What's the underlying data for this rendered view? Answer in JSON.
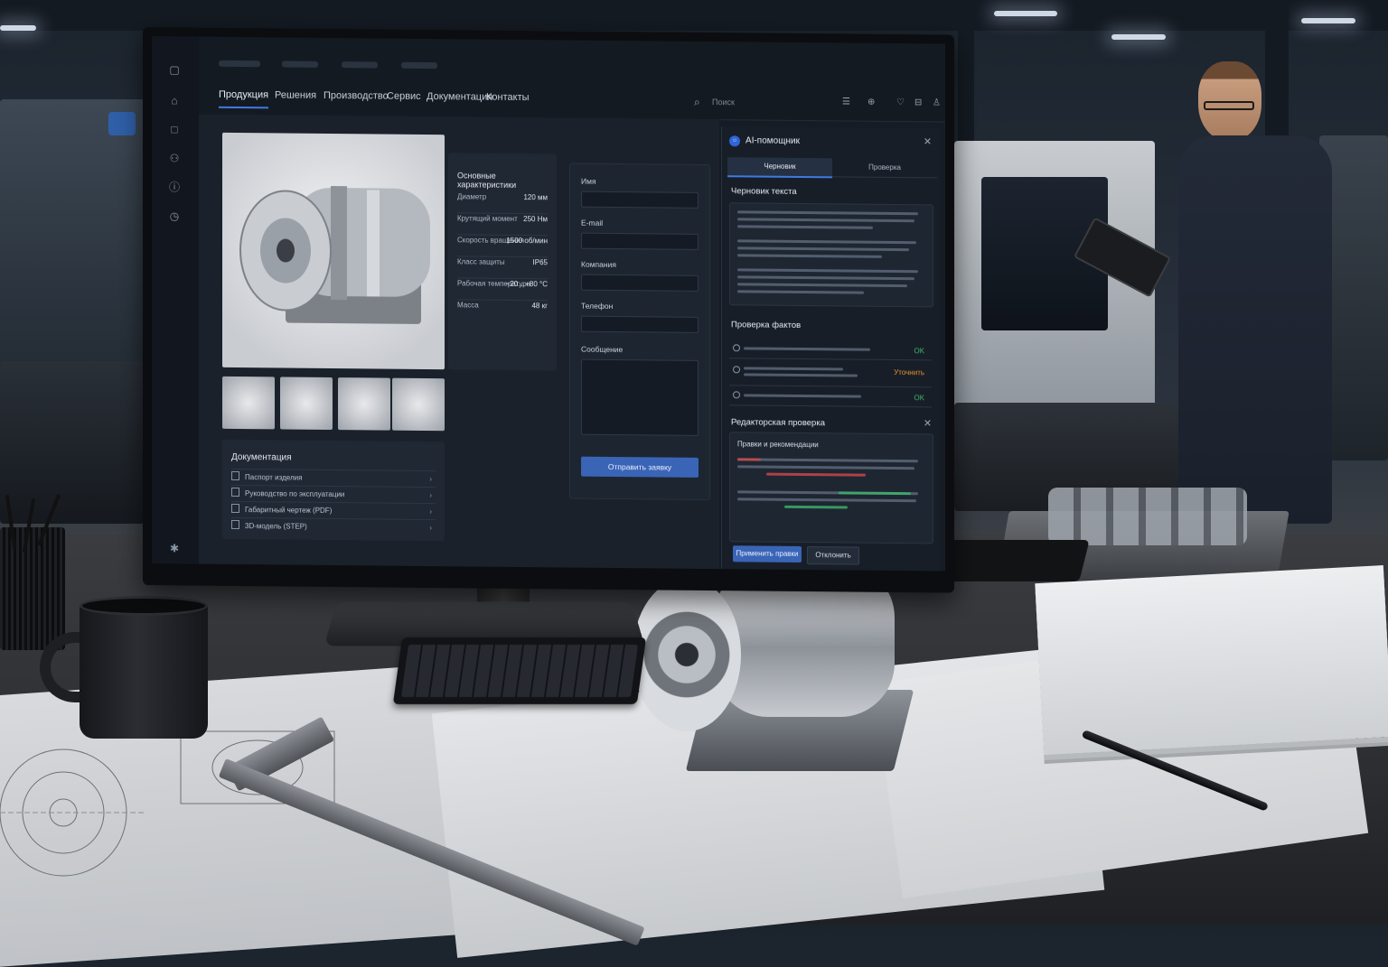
{
  "nav": {
    "items": [
      "Продукция",
      "Решения",
      "Производство",
      "Сервис",
      "Документация",
      "Контакты"
    ],
    "active_index": 0,
    "search_placeholder": "Поиск"
  },
  "specs": {
    "title": "Основные характеристики",
    "rows": [
      {
        "label": "Диаметр",
        "value": "120 мм"
      },
      {
        "label": "Крутящий момент",
        "value": "250 Нм"
      },
      {
        "label": "Скорость вращения",
        "value": "1500 об/мин"
      },
      {
        "label": "Класс защиты",
        "value": "IP65"
      },
      {
        "label": "Рабочая температура",
        "value": "−20…+80 °C"
      },
      {
        "label": "Масса",
        "value": "48 кг"
      }
    ]
  },
  "documents": {
    "title": "Документация",
    "items": [
      "Паспорт изделия",
      "Руководство по эксплуатации",
      "Габаритный чертеж (PDF)",
      "3D-модель (STEP)"
    ]
  },
  "form": {
    "fields": [
      "Имя",
      "E-mail",
      "Компания",
      "Телефон"
    ],
    "message_label": "Сообщение",
    "submit_label": "Отправить заявку"
  },
  "ai_panel": {
    "title": "AI-помощник",
    "tabs": [
      "Черновик",
      "Проверка"
    ],
    "active_tab": 0,
    "draft_heading": "Черновик текста",
    "facts_heading": "Проверка фактов",
    "facts": [
      {
        "status": "OK"
      },
      {
        "status": "Уточнить"
      },
      {
        "status": "OK"
      }
    ],
    "editor_heading": "Редакторская проверка",
    "editor_subheading": "Правки и рекомендации",
    "apply_label": "Применить правки",
    "reject_label": "Отклонить"
  },
  "colors": {
    "accent": "#3f7ae0",
    "ok": "#3fb56a",
    "warn": "#e3922e"
  }
}
